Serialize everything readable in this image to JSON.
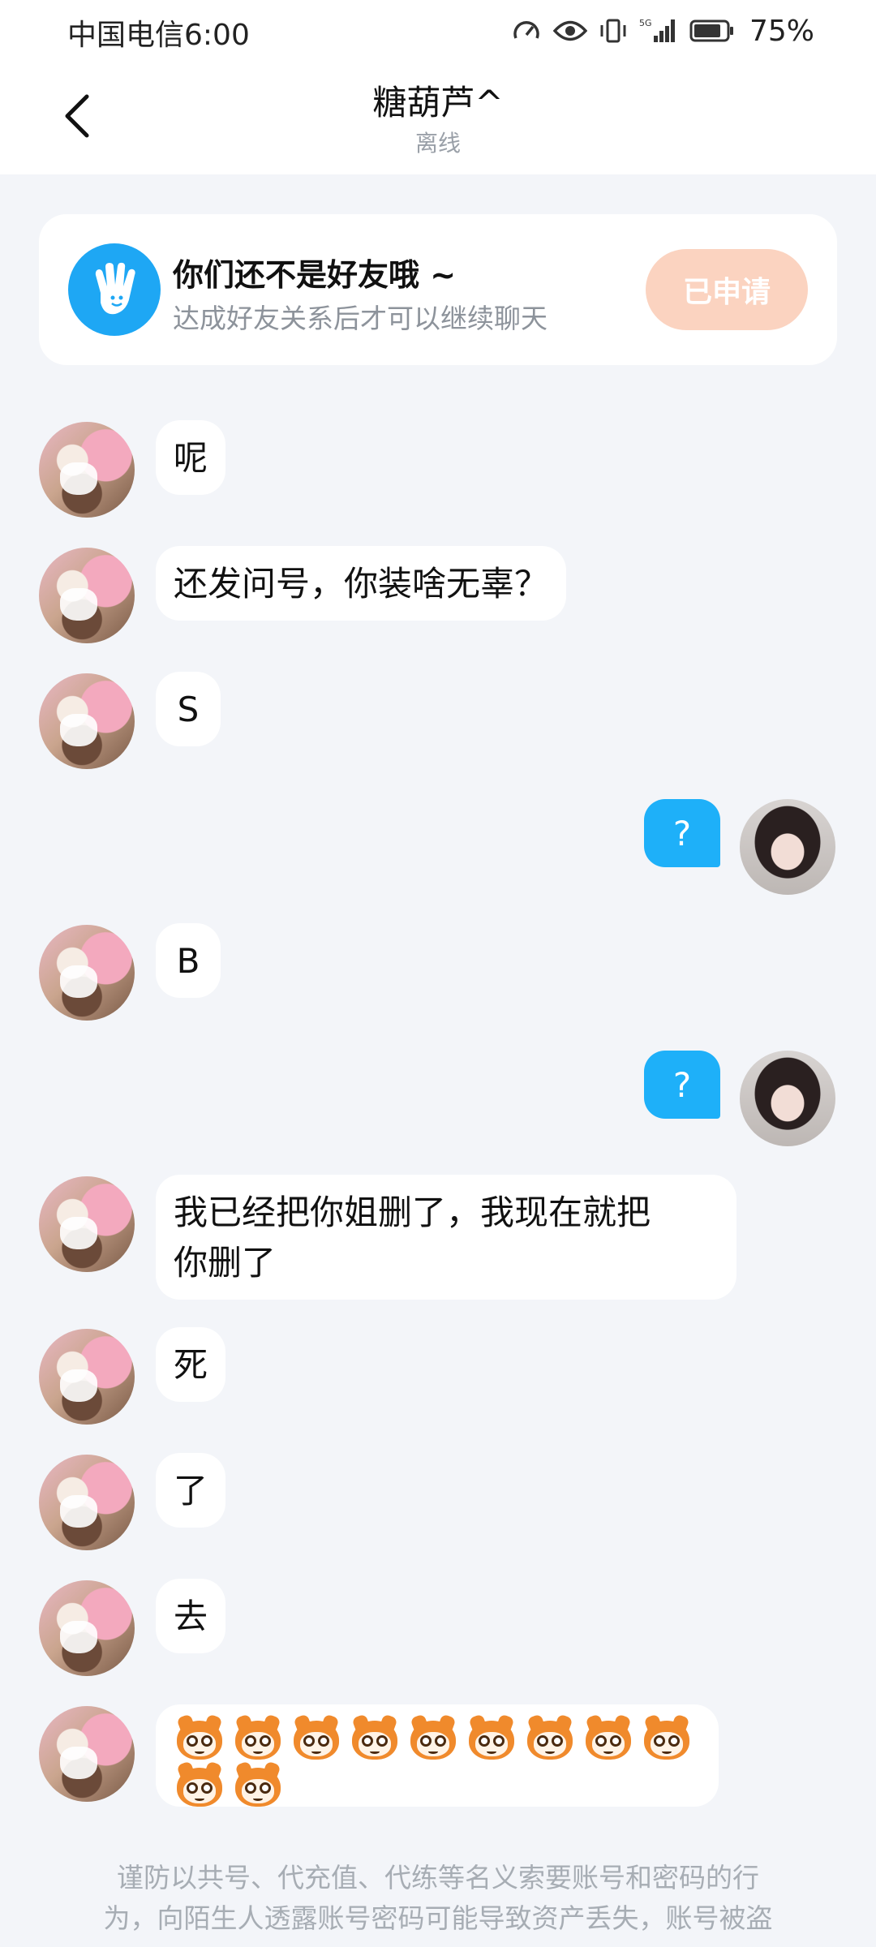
{
  "status_bar": {
    "carrier_time": "中国电信6:00",
    "battery": "75%",
    "icons": [
      "speedometer-icon",
      "eye-icon",
      "vibrate-icon",
      "5g-signal-icon",
      "battery-icon"
    ]
  },
  "header": {
    "title": "糖葫芦^",
    "subtitle": "离线",
    "back_icon": "chevron-left-icon"
  },
  "notice": {
    "icon": "hand-wave-icon",
    "title": "你们还不是好友哦 ~",
    "subtitle": "达成好友关系后才可以继续聊天",
    "button": "已申请",
    "accent": "#1ea7f4",
    "button_color": "#fbd3c0"
  },
  "messages": [
    {
      "side": "left",
      "text": "呢"
    },
    {
      "side": "left",
      "text": "还发问号，你装啥无辜？"
    },
    {
      "side": "left",
      "text": "S"
    },
    {
      "side": "right",
      "text": "?"
    },
    {
      "side": "left",
      "text": "B"
    },
    {
      "side": "right",
      "text": "?"
    },
    {
      "side": "left",
      "line1": "我已经把你姐删了，我现在就把",
      "line2": "你删了"
    },
    {
      "side": "left",
      "text": "死"
    },
    {
      "side": "left",
      "text": "了"
    },
    {
      "side": "left",
      "text": "去"
    },
    {
      "side": "left",
      "emoji": "monkey-face-icon",
      "count": 11
    }
  ],
  "footer": {
    "line1": "谨防以共号、代充值、代练等名义索要账号和密码的行",
    "line2": "为，向陌生人透露账号密码可能导致资产丢失，账号被盗"
  },
  "colors": {
    "background": "#f3f5f9",
    "sent_bubble": "#1eb0f9",
    "received_bubble": "#ffffff"
  }
}
